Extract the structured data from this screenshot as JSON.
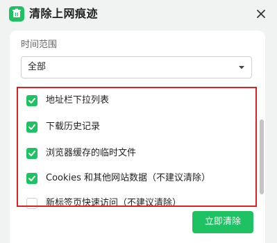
{
  "dialog": {
    "title": "清除上网痕迹",
    "app_icon": "trash-bin-icon",
    "close_icon": "close-icon"
  },
  "time_range": {
    "label": "时间范围",
    "selected": "全部",
    "caret_icon": "caret-down-icon"
  },
  "items": [
    {
      "label": "地址栏下拉列表",
      "checked": true
    },
    {
      "label": "下载历史记录",
      "checked": true
    },
    {
      "label": "浏览器缓存的临时文件",
      "checked": true
    },
    {
      "label": "Cookies 和其他网站数据（不建议清除）",
      "checked": true
    },
    {
      "label": "新标签页快速访问（不建议清除）",
      "checked": false
    }
  ],
  "actions": {
    "clear_now": "立即清除"
  },
  "colors": {
    "accent": "#1ec262",
    "highlight": "#e02020",
    "background": "#f1f3f2",
    "panel": "#ffffff"
  }
}
